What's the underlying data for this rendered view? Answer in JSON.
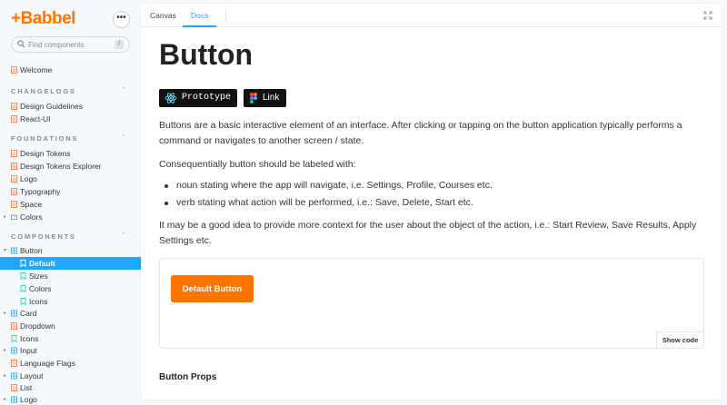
{
  "sidebar": {
    "brand": "+Babbel",
    "menu_label": "•••",
    "search": {
      "placeholder": "Find components",
      "shortcut": "/"
    },
    "welcome": "Welcome",
    "sections": [
      {
        "title": "CHANGELOGS",
        "items": [
          "Design Guidelines",
          "React-UI"
        ]
      },
      {
        "title": "FOUNDATIONS",
        "items": [
          "Design Tokens",
          "Design Tokens Explorer",
          "Logo",
          "Typography",
          "Space",
          "Colors"
        ]
      },
      {
        "title": "COMPONENTS",
        "items": [
          "Button",
          "Default",
          "Sizes",
          "Colors",
          "Icons",
          "Card",
          "Dropdown",
          "Icons",
          "Input",
          "Language Flags",
          "Layout",
          "List",
          "Logo"
        ]
      }
    ]
  },
  "tabs": {
    "canvas": "Canvas",
    "docs": "Docs"
  },
  "doc": {
    "title": "Button",
    "badge_prototype": "Prototype",
    "badge_link": "Link",
    "intro": "Buttons are a basic interactive element of an interface. After clicking or tapping on the button application typically performs a command or navigates to another screen / state.",
    "labeled_with": "Consequentially button should be labeled with:",
    "bullets": [
      "noun stating where the app will navigate, i.e. Settings, Profile, Courses etc.",
      "verb stating what action will be performed, i.e.: Save, Delete, Start etc."
    ],
    "context": "It may be a good idea to provide more context for the user about the object of the action, i.e.: Start Review, Save Results, Apply Settings etc.",
    "preview_button": "Default Button",
    "show_code": "Show code",
    "props_heading": "Button Props"
  },
  "colors": {
    "brand": "#ff7500",
    "accent": "#1ea7fd",
    "badge_bg": "#111111"
  }
}
